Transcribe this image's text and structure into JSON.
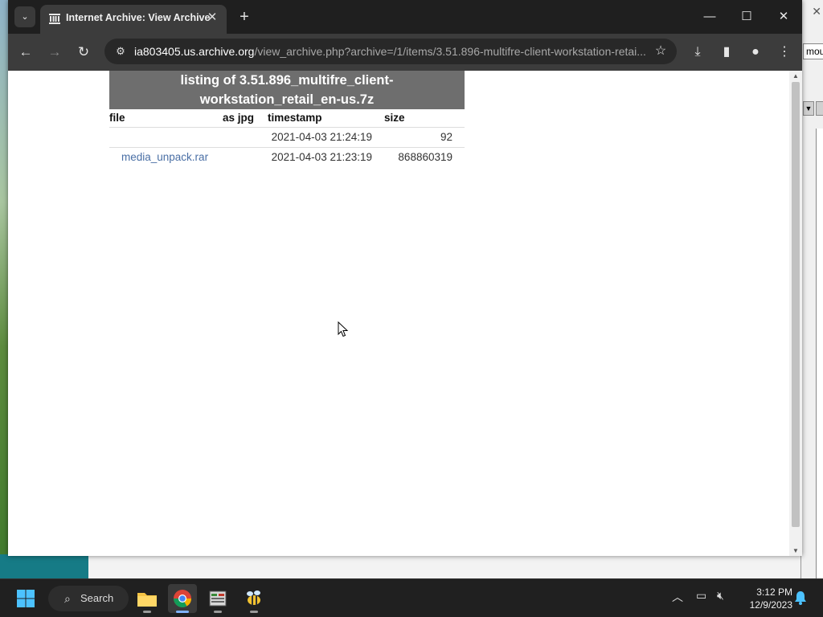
{
  "browser": {
    "tab_title": "Internet Archive: View Archive",
    "url_domain": "ia803405.us.archive.org",
    "url_path": "/view_archive.php?archive=/1/items/3.51.896-multifre-client-workstation-retai..."
  },
  "page": {
    "listing_title_line1": "listing of 3.51.896_multifre_client-",
    "listing_title_line2": "workstation_retail_en-us.7z",
    "columns": {
      "file": "file",
      "as_jpg": "as jpg",
      "timestamp": "timestamp",
      "size": "size"
    },
    "rows": [
      {
        "file": "",
        "timestamp": "2021-04-03 21:24:19",
        "size": "92"
      },
      {
        "file": "media_unpack.rar",
        "timestamp": "2021-04-03 21:23:19",
        "size": "868860319"
      }
    ]
  },
  "background_window": {
    "tab_label": "mou"
  },
  "taskbar": {
    "search_label": "Search",
    "time": "3:12 PM",
    "date": "12/9/2023"
  },
  "colors": {
    "link": "#4a6fa5",
    "header_bg": "#6e6e6e",
    "chrome_dark": "#1f1f1f",
    "taskbar": "#202020"
  }
}
